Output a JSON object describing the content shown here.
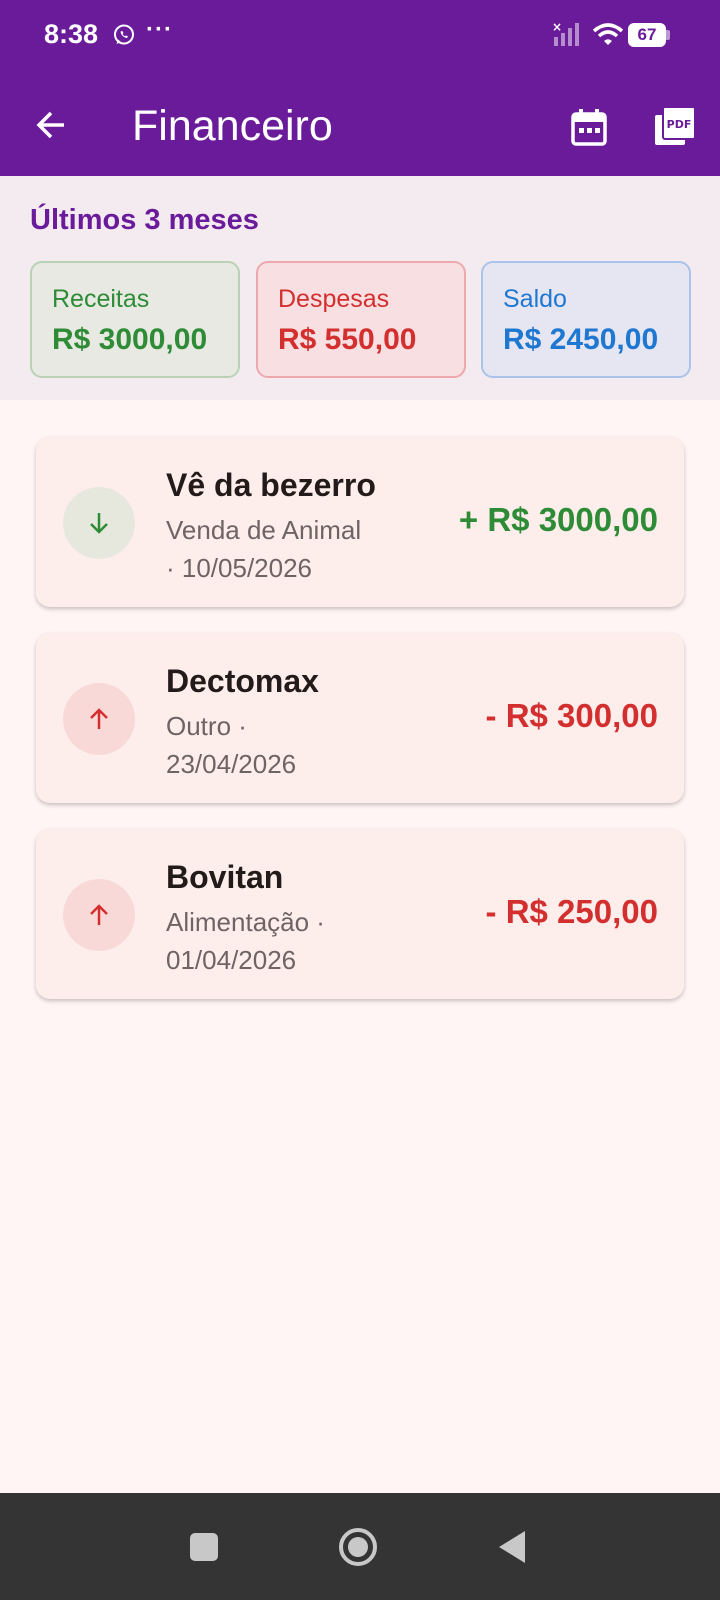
{
  "status_bar": {
    "time": "8:38",
    "dots": "···",
    "battery": "67"
  },
  "appbar": {
    "title": "Financeiro",
    "icons": [
      "back-arrow-icon",
      "calendar-icon",
      "pdf-icon"
    ]
  },
  "summary": {
    "title": "Últimos 3 meses",
    "cards": [
      {
        "label": "Receitas",
        "value": "R$ 3000,00",
        "color": "#2e8b36"
      },
      {
        "label": "Despesas",
        "value": "R$ 550,00",
        "color": "#d32f2f"
      },
      {
        "label": "Saldo",
        "value": "R$ 2450,00",
        "color": "#1e78d2"
      }
    ]
  },
  "transactions": [
    {
      "title": "Vê da bezerro",
      "category": "Venda de Animal",
      "date": "10/05/2026",
      "amount": "+ R$ 3000,00",
      "type": "in",
      "icon": "arrow-down-icon"
    },
    {
      "title": "Dectomax",
      "category": "Outro",
      "date": "23/04/2026",
      "amount": "- R$ 300,00",
      "type": "out",
      "icon": "arrow-up-icon"
    },
    {
      "title": "Bovitan",
      "category": "Alimentação",
      "date": "01/04/2026",
      "amount": "- R$ 250,00",
      "type": "out",
      "icon": "arrow-up-icon"
    }
  ],
  "colors": {
    "primary": "#6a1b9a",
    "income": "#2e8b36",
    "expense": "#d32f2f",
    "balance": "#1e78d2"
  }
}
